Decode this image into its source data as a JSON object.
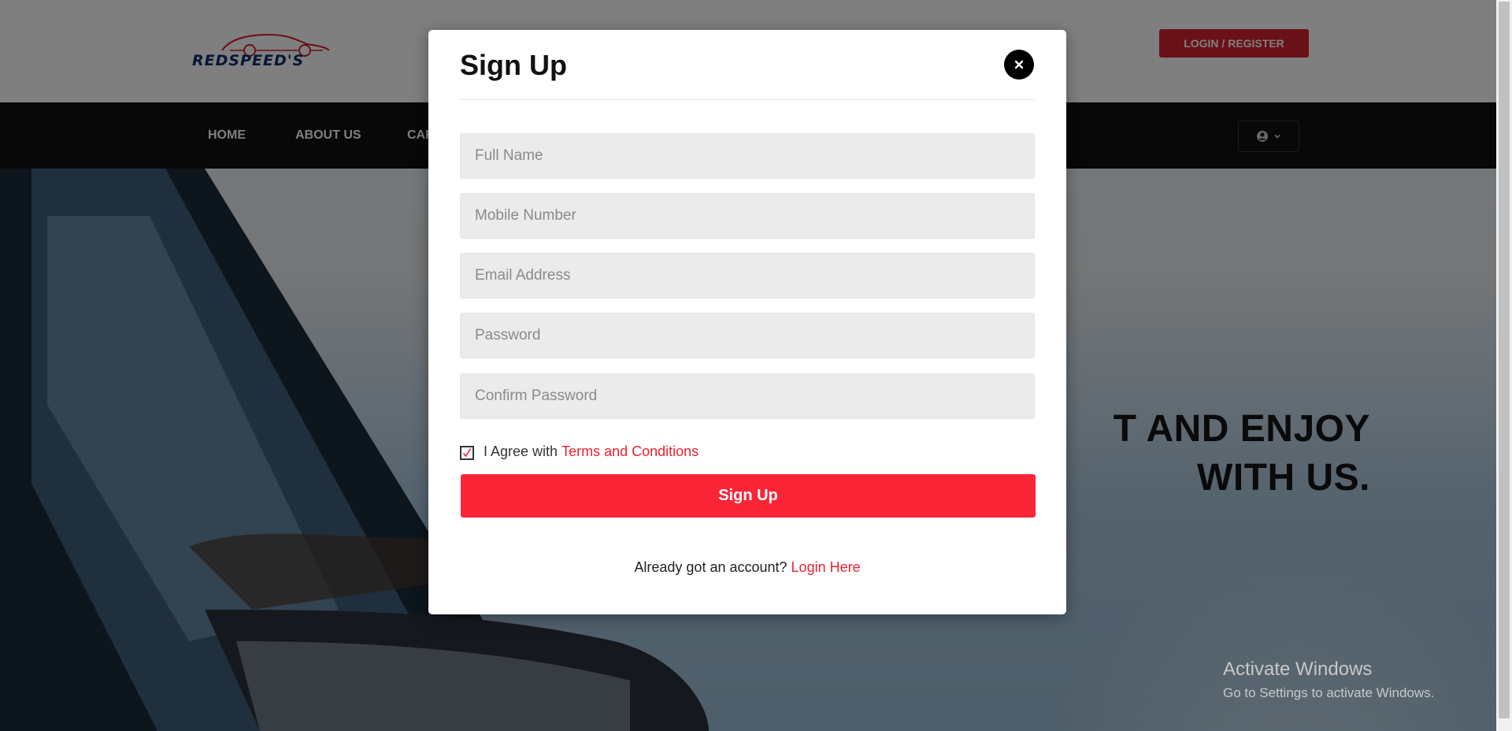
{
  "header": {
    "logo_text": "REDSPEED'S",
    "login_register_label": "LOGIN / REGISTER"
  },
  "nav": {
    "items": [
      "HOME",
      "ABOUT US",
      "CAR"
    ]
  },
  "hero": {
    "line1": "T AND ENJOY",
    "line2": "WITH US."
  },
  "modal": {
    "title": "Sign Up",
    "close_symbol": "×",
    "fields": {
      "full_name": "Full Name",
      "mobile": "Mobile Number",
      "email": "Email Address",
      "password": "Password",
      "confirm_password": "Confirm Password"
    },
    "agree_text": "I Agree with",
    "terms_link": "Terms and Conditions",
    "agree_checked": true,
    "submit_label": "Sign Up",
    "footer_text": "Already got an account?",
    "login_link": "Login Here"
  },
  "watermark": {
    "title": "Activate Windows",
    "subtitle": "Go to Settings to activate Windows."
  },
  "colors": {
    "accent": "#fa2437",
    "brand_red": "#d4202e",
    "nav_bg": "#111111"
  },
  "icons": {
    "logo": "car-silhouette-icon",
    "close": "close-icon",
    "user": "user-circle-icon",
    "dropdown": "chevron-down-icon",
    "check": "check-icon"
  }
}
